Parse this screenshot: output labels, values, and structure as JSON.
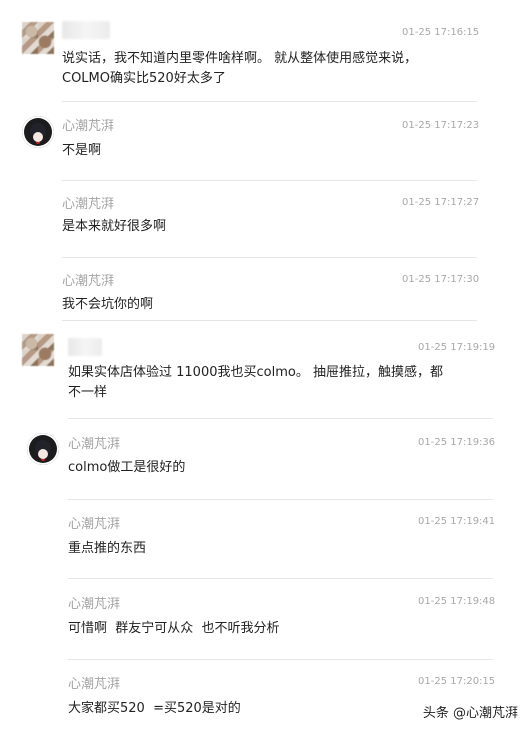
{
  "comments": [
    {
      "name": "",
      "time": "01-25 17:16:15",
      "text": "说实话，我不知道内里零件啥样啊。 就从整体使用感觉来说，\nCOLMO确实比520好太多了",
      "avatar": "blurred-avatar"
    },
    {
      "name": "心潮芃湃",
      "time": "01-25 17:17:23",
      "text": "不是啊",
      "avatar": "anime-avatar"
    },
    {
      "name": "心潮芃湃",
      "time": "01-25 17:17:27",
      "text": "是本来就好很多啊",
      "avatar": ""
    },
    {
      "name": "心潮芃湃",
      "time": "01-25 17:17:30",
      "text": "我不会坑你的啊",
      "avatar": ""
    },
    {
      "name": "",
      "time": "01-25 17:19:19",
      "text": "如果实体店体验过 11000我也买colmo。 抽屉推拉，触摸感，都\n不一样",
      "avatar": "blurred-avatar"
    },
    {
      "name": "心潮芃湃",
      "time": "01-25 17:19:36",
      "text": "colmo做工是很好的",
      "avatar": "anime-avatar"
    },
    {
      "name": "心潮芃湃",
      "time": "01-25 17:19:41",
      "text": "重点推的东西",
      "avatar": ""
    },
    {
      "name": "心潮芃湃",
      "time": "01-25 17:19:48",
      "text": "可惜啊  群友宁可从众  也不听我分析",
      "avatar": ""
    },
    {
      "name": "心潮芃湃",
      "time": "01-25 17:20:15",
      "text": "大家都买520  =买520是对的",
      "avatar": ""
    }
  ],
  "watermark": "头条 @心潮芃湃"
}
